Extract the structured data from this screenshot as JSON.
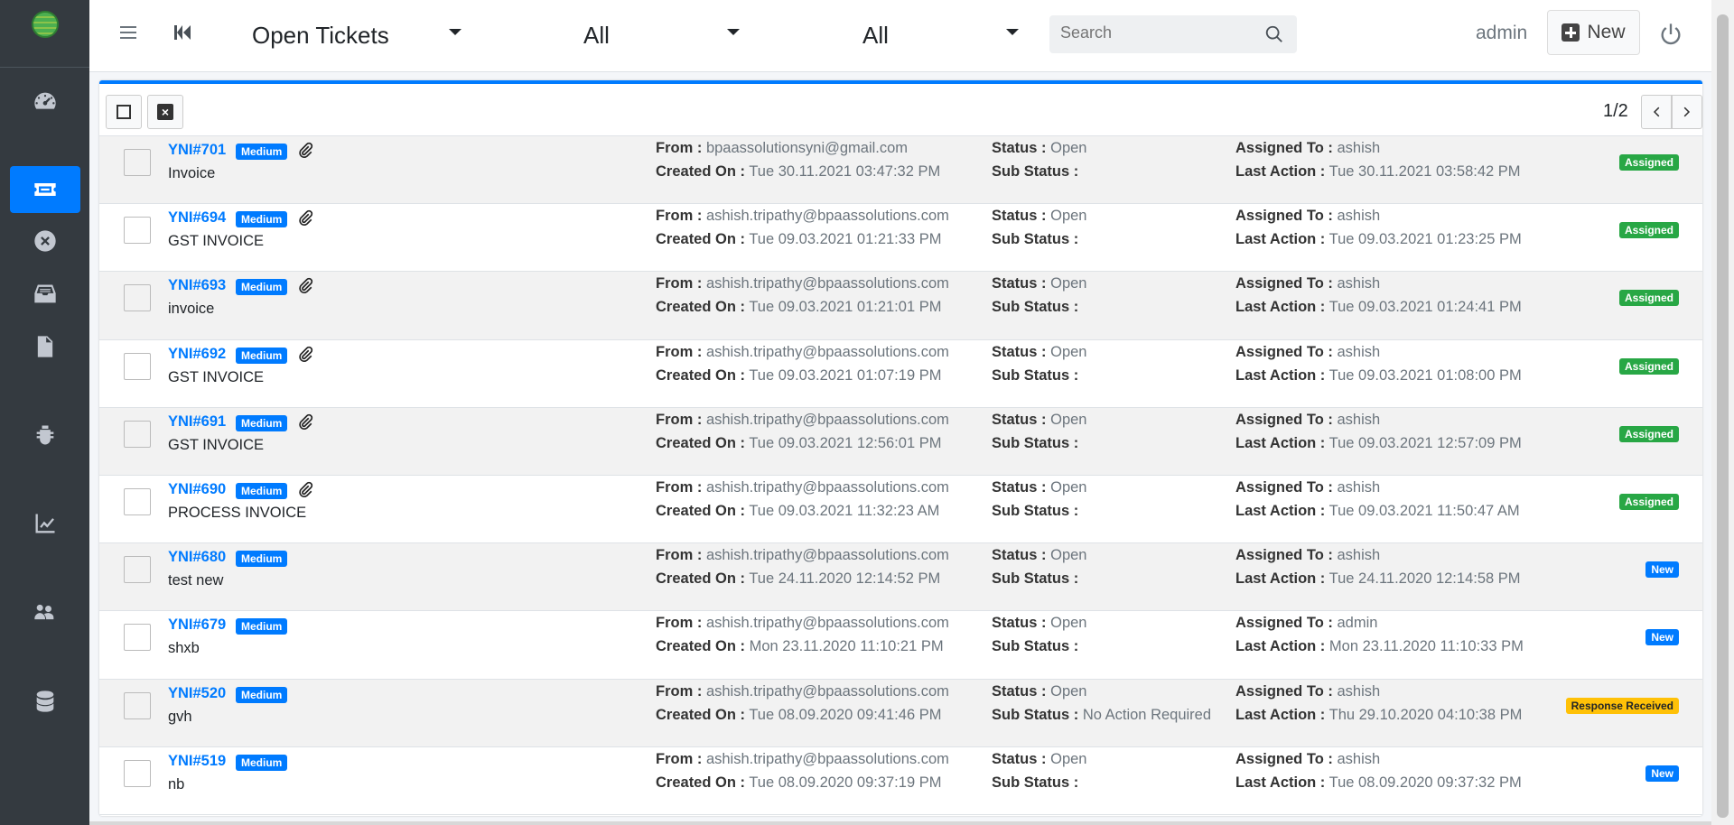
{
  "topbar": {
    "view_select": "Open Tickets",
    "filter1": "All",
    "filter2": "All",
    "search_placeholder": "Search",
    "user": "admin",
    "new_label": "New"
  },
  "pager": {
    "text": "1/2"
  },
  "labels": {
    "from": "From :",
    "created": "Created On :",
    "status": "Status :",
    "sub_status": "Sub Status :",
    "assigned": "Assigned To :",
    "last_action": "Last Action :"
  },
  "sidebar": {
    "items": [
      "dashboard-icon",
      "ticket-icon",
      "close-circle-icon",
      "inbox-icon",
      "file-icon",
      "bug-icon",
      "chart-line-icon",
      "users-cog-icon",
      "database-icon"
    ],
    "active": "ticket-icon"
  },
  "colors": {
    "primary": "#007bff",
    "success": "#28a745",
    "warning": "#ffc107",
    "sidebar": "#343a40"
  },
  "tickets": [
    {
      "id": "YNI#701",
      "priority": "Medium",
      "attachment": true,
      "subject": "Invoice",
      "from": "bpaassolutionsyni@gmail.com",
      "created": "Tue 30.11.2021 03:47:32 PM",
      "status": "Open",
      "sub_status": "",
      "assigned": "ashish",
      "last_action": "Tue 30.11.2021 03:58:42 PM",
      "badge": "Assigned"
    },
    {
      "id": "YNI#694",
      "priority": "Medium",
      "attachment": true,
      "subject": "GST INVOICE",
      "from": "ashish.tripathy@bpaassolutions.com",
      "created": "Tue 09.03.2021 01:21:33 PM",
      "status": "Open",
      "sub_status": "",
      "assigned": "ashish",
      "last_action": "Tue 09.03.2021 01:23:25 PM",
      "badge": "Assigned"
    },
    {
      "id": "YNI#693",
      "priority": "Medium",
      "attachment": true,
      "subject": "invoice",
      "from": "ashish.tripathy@bpaassolutions.com",
      "created": "Tue 09.03.2021 01:21:01 PM",
      "status": "Open",
      "sub_status": "",
      "assigned": "ashish",
      "last_action": "Tue 09.03.2021 01:24:41 PM",
      "badge": "Assigned"
    },
    {
      "id": "YNI#692",
      "priority": "Medium",
      "attachment": true,
      "subject": "GST INVOICE",
      "from": "ashish.tripathy@bpaassolutions.com",
      "created": "Tue 09.03.2021 01:07:19 PM",
      "status": "Open",
      "sub_status": "",
      "assigned": "ashish",
      "last_action": "Tue 09.03.2021 01:08:00 PM",
      "badge": "Assigned"
    },
    {
      "id": "YNI#691",
      "priority": "Medium",
      "attachment": true,
      "subject": "GST INVOICE",
      "from": "ashish.tripathy@bpaassolutions.com",
      "created": "Tue 09.03.2021 12:56:01 PM",
      "status": "Open",
      "sub_status": "",
      "assigned": "ashish",
      "last_action": "Tue 09.03.2021 12:57:09 PM",
      "badge": "Assigned"
    },
    {
      "id": "YNI#690",
      "priority": "Medium",
      "attachment": true,
      "subject": "PROCESS INVOICE",
      "from": "ashish.tripathy@bpaassolutions.com",
      "created": "Tue 09.03.2021 11:32:23 AM",
      "status": "Open",
      "sub_status": "",
      "assigned": "ashish",
      "last_action": "Tue 09.03.2021 11:50:47 AM",
      "badge": "Assigned"
    },
    {
      "id": "YNI#680",
      "priority": "Medium",
      "attachment": false,
      "subject": "test new",
      "from": "ashish.tripathy@bpaassolutions.com",
      "created": "Tue 24.11.2020 12:14:52 PM",
      "status": "Open",
      "sub_status": "",
      "assigned": "ashish",
      "last_action": "Tue 24.11.2020 12:14:58 PM",
      "badge": "New"
    },
    {
      "id": "YNI#679",
      "priority": "Medium",
      "attachment": false,
      "subject": "shxb",
      "from": "ashish.tripathy@bpaassolutions.com",
      "created": "Mon 23.11.2020 11:10:21 PM",
      "status": "Open",
      "sub_status": "",
      "assigned": "admin",
      "last_action": "Mon 23.11.2020 11:10:33 PM",
      "badge": "New"
    },
    {
      "id": "YNI#520",
      "priority": "Medium",
      "attachment": false,
      "subject": "gvh",
      "from": "ashish.tripathy@bpaassolutions.com",
      "created": "Tue 08.09.2020 09:41:46 PM",
      "status": "Open",
      "sub_status": "No Action Required",
      "assigned": "ashish",
      "last_action": "Thu 29.10.2020 04:10:38 PM",
      "badge": "Response Received"
    },
    {
      "id": "YNI#519",
      "priority": "Medium",
      "attachment": false,
      "subject": "nb",
      "from": "ashish.tripathy@bpaassolutions.com",
      "created": "Tue 08.09.2020 09:37:19 PM",
      "status": "Open",
      "sub_status": "",
      "assigned": "ashish",
      "last_action": "Tue 08.09.2020 09:37:32 PM",
      "badge": "New"
    }
  ]
}
